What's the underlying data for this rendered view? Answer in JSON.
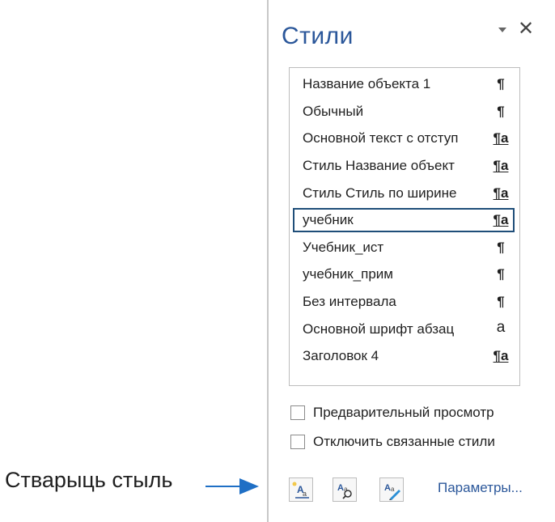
{
  "pane": {
    "title": "Стили",
    "menu_icon": "dropdown-triangle-icon",
    "close_icon": "close-icon",
    "close_symbol": "✕"
  },
  "styles": [
    {
      "name": "Название объекта 1",
      "glyph": "¶",
      "kind": "paragraph",
      "selected": false
    },
    {
      "name": "Обычный",
      "glyph": "¶",
      "kind": "paragraph",
      "selected": false
    },
    {
      "name": "Основной текст с отступ",
      "glyph": "¶a",
      "kind": "linked",
      "selected": false
    },
    {
      "name": "Стиль Название объект",
      "glyph": "¶a",
      "kind": "linked",
      "selected": false
    },
    {
      "name": "Стиль Стиль по ширине",
      "glyph": "¶a",
      "kind": "linked",
      "selected": false
    },
    {
      "name": "учебник",
      "glyph": "¶a",
      "kind": "linked",
      "selected": true
    },
    {
      "name": "Учебник_ист",
      "glyph": "¶",
      "kind": "paragraph",
      "selected": false
    },
    {
      "name": "учебник_прим",
      "glyph": "¶",
      "kind": "paragraph",
      "selected": false
    },
    {
      "name": "Без интервала",
      "glyph": "¶",
      "kind": "paragraph",
      "selected": false
    },
    {
      "name": "Основной шрифт абзац",
      "glyph": "a",
      "kind": "character",
      "selected": false
    },
    {
      "name": "Заголовок 4",
      "glyph": "¶a",
      "kind": "linked",
      "selected": false
    }
  ],
  "options": {
    "preview_label": "Предварительный просмотр",
    "preview_checked": false,
    "disable_linked_label": "Отключить связанные стили",
    "disable_linked_checked": false
  },
  "toolbar": {
    "new_style_icon": "new-style-icon",
    "style_inspector_icon": "style-inspector-icon",
    "manage_styles_icon": "manage-styles-icon",
    "options_link": "Параметры..."
  },
  "callout": {
    "text": "Стварыць стыль",
    "arrow_color": "#1f6fc5"
  },
  "colors": {
    "accent": "#2b579a",
    "selection_border": "#1f4e79"
  }
}
